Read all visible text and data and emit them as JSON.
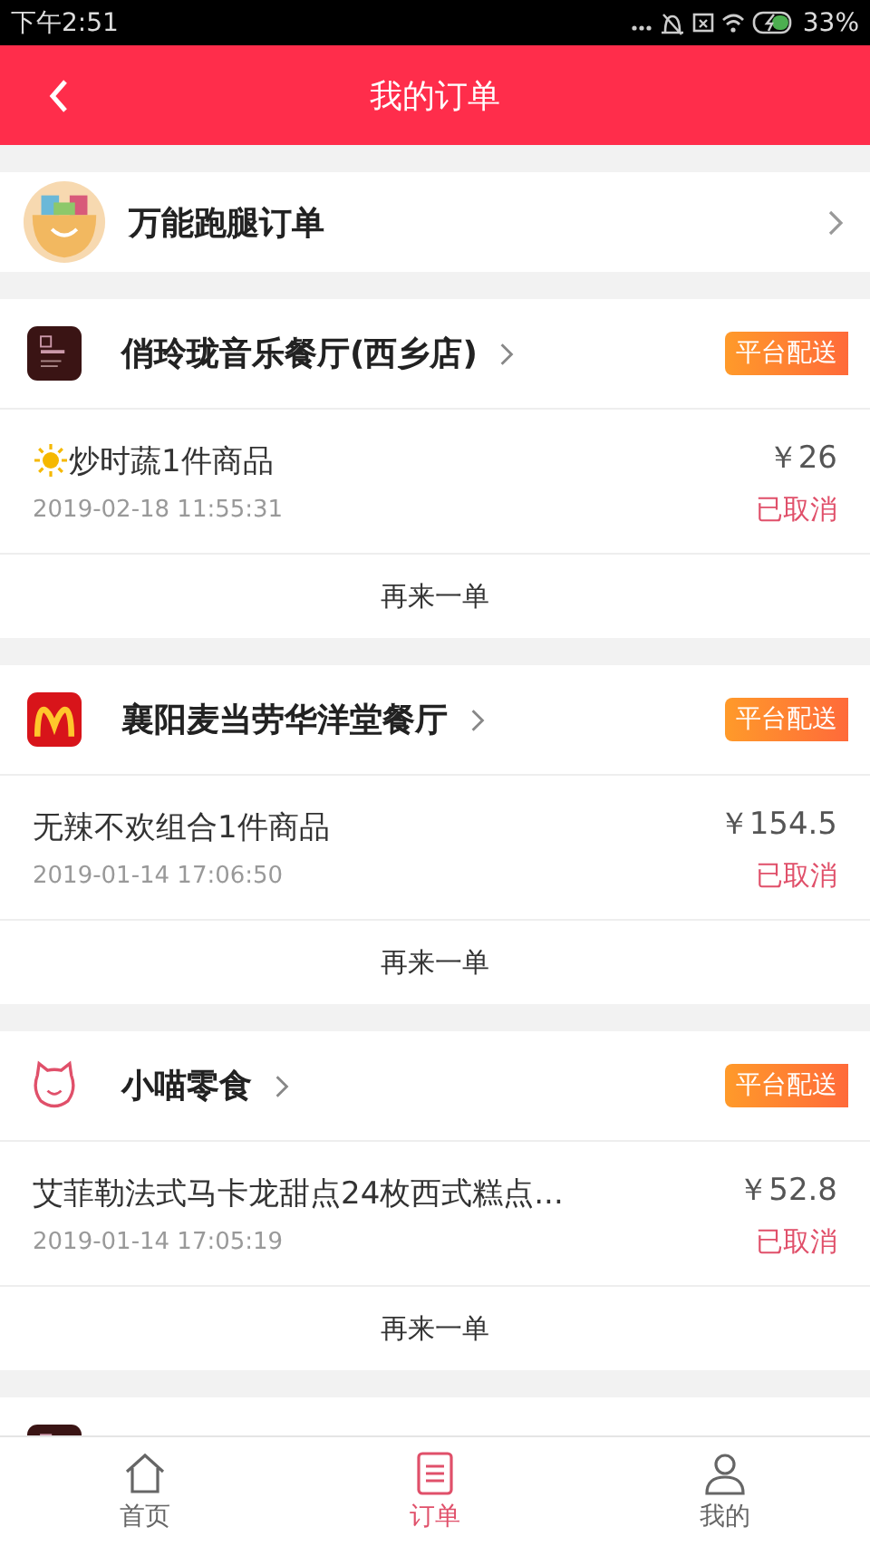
{
  "status_bar": {
    "time": "下午2:51",
    "battery": "33%"
  },
  "header": {
    "title": "我的订单"
  },
  "errand": {
    "title": "万能跑腿订单"
  },
  "orders": [
    {
      "store": "俏玲珑音乐餐厅(西乡店)",
      "badge": "平台配送",
      "item": "炒时蔬1件商品",
      "time": "2019-02-18 11:55:31",
      "price": "￥26",
      "status": "已取消",
      "reorder": "再来一单"
    },
    {
      "store": "襄阳麦当劳华洋堂餐厅",
      "badge": "平台配送",
      "item": "无辣不欢组合1件商品",
      "time": "2019-01-14 17:06:50",
      "price": "￥154.5",
      "status": "已取消",
      "reorder": "再来一单"
    },
    {
      "store": "小喵零食",
      "badge": "平台配送",
      "item": "艾菲勒法式马卡龙甜点24枚西式糕点...",
      "time": "2019-01-14 17:05:19",
      "price": "￥52.8",
      "status": "已取消",
      "reorder": "再来一单"
    }
  ],
  "tabs": [
    {
      "label": "首页",
      "selected": false
    },
    {
      "label": "订单",
      "selected": true
    },
    {
      "label": "我的",
      "selected": false
    }
  ]
}
